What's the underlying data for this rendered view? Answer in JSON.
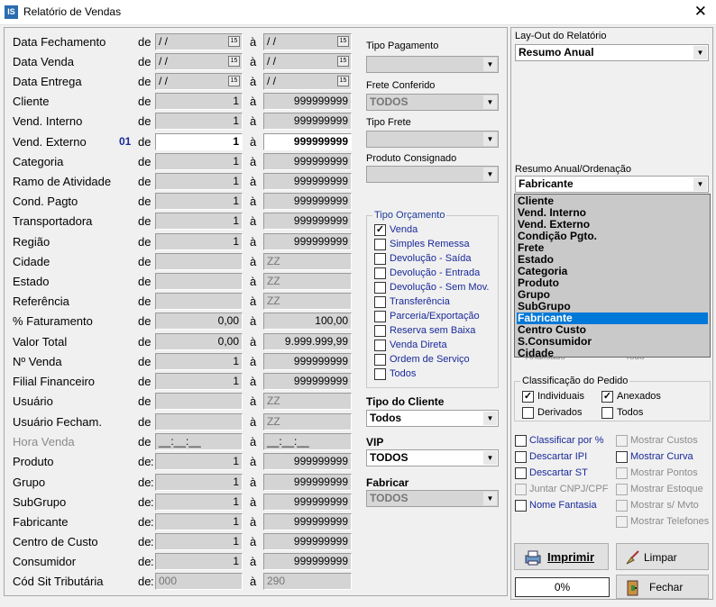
{
  "window": {
    "title": "Relatório de Vendas",
    "app_icon": "IS"
  },
  "filters": {
    "de": "de",
    "a": "à",
    "rows": [
      {
        "label": "Data Fechamento",
        "from": "/ /",
        "to": "/ /"
      },
      {
        "label": "Data Venda",
        "from": "/ /",
        "to": "/ /"
      },
      {
        "label": "Data Entrega",
        "from": "/ /",
        "to": "/ /"
      },
      {
        "label": "Cliente",
        "from": "1",
        "to": "999999999"
      },
      {
        "label": "Vend. Interno",
        "from": "1",
        "to": "999999999"
      },
      {
        "label": "Vend. Externo",
        "code": "01",
        "from": "1",
        "to": "999999999"
      },
      {
        "label": "Categoria",
        "from": "1",
        "to": "999999999"
      },
      {
        "label": "Ramo de Atividade",
        "from": "1",
        "to": "999999999"
      },
      {
        "label": "Cond. Pagto",
        "from": "1",
        "to": "999999999"
      },
      {
        "label": "Transportadora",
        "from": "1",
        "to": "999999999"
      },
      {
        "label": "Região",
        "from": "1",
        "to": "999999999"
      },
      {
        "label": "Cidade",
        "from": "",
        "to": "ZZ"
      },
      {
        "label": "Estado",
        "from": "",
        "to": "ZZ"
      },
      {
        "label": "Referência",
        "from": "",
        "to": "ZZ"
      },
      {
        "label": "% Faturamento",
        "from": "0,00",
        "to": "100,00"
      },
      {
        "label": "Valor Total",
        "from": "0,00",
        "to": "9.999.999,99"
      },
      {
        "label": "Nº Venda",
        "from": "1",
        "to": "999999999"
      },
      {
        "label": "Filial Financeiro",
        "from": "1",
        "to": "999999999"
      },
      {
        "label": "Usuário",
        "from": "",
        "to": "ZZ"
      },
      {
        "label": "Usuário Fecham.",
        "from": "",
        "to": "ZZ"
      },
      {
        "label": "Hora Venda",
        "from": "__:__:__",
        "to": "__:__:__"
      },
      {
        "label": "Produto",
        "from": "1",
        "to": "999999999"
      },
      {
        "label": "Grupo",
        "from": "1",
        "to": "999999999"
      },
      {
        "label": "SubGrupo",
        "from": "1",
        "to": "999999999"
      },
      {
        "label": "Fabricante",
        "from": "1",
        "to": "999999999"
      },
      {
        "label": "Centro de Custo",
        "from": "1",
        "to": "999999999"
      },
      {
        "label": "Consumidor",
        "from": "1",
        "to": "999999999"
      },
      {
        "label": "Cód Sit Tributária",
        "from": "000",
        "to": "290"
      }
    ]
  },
  "middle": {
    "tipo_pagamento_label": "Tipo Pagamento",
    "tipo_pagamento_value": "",
    "frete_conferido_label": "Frete Conferido",
    "frete_conferido_value": "TODOS",
    "tipo_frete_label": "Tipo Frete",
    "tipo_frete_value": "",
    "produto_consignado_label": "Produto Consignado",
    "produto_consignado_value": "",
    "tipo_orcamento_title": "Tipo Orçamento",
    "tipo_orcamento": [
      {
        "label": "Venda",
        "checked": true
      },
      {
        "label": "Simples Remessa",
        "checked": false
      },
      {
        "label": "Devolução - Saída",
        "checked": false
      },
      {
        "label": "Devolução - Entrada",
        "checked": false
      },
      {
        "label": "Devolução - Sem Mov.",
        "checked": false
      },
      {
        "label": "Transferência",
        "checked": false
      },
      {
        "label": "Parceria/Exportação",
        "checked": false
      },
      {
        "label": "Reserva sem Baixa",
        "checked": false
      },
      {
        "label": "Venda Direta",
        "checked": false
      },
      {
        "label": "Ordem de Serviço",
        "checked": false
      },
      {
        "label": "Todos",
        "checked": false
      }
    ],
    "tipo_cliente_label": "Tipo do Cliente",
    "tipo_cliente_value": "Todos",
    "vip_label": "VIP",
    "vip_value": "TODOS",
    "fabricar_label": "Fabricar",
    "fabricar_value": "TODOS"
  },
  "right": {
    "layout_label": "Lay-Out do Relatório",
    "layout_value": "Resumo Anual",
    "ordenacao_label": "Resumo Anual/Ordenação",
    "ordenacao_value": "Fabricante",
    "ordenacao_options": [
      "Cliente",
      "Vend. Interno",
      "Vend. Externo",
      "Condição Pgto.",
      "Frete",
      "Estado",
      "Categoria",
      "Produto",
      "Grupo",
      "SubGrupo",
      "Fabricante",
      "Centro Custo",
      "S.Consumidor",
      "Cidade"
    ],
    "selected_option": "Fabricante",
    "hidden_behind_a": "Analisado",
    "hidden_behind_b": "Todo",
    "classificacao_title": "Classificação do Pedido",
    "classificacao": [
      {
        "label": "Individuais",
        "checked": true
      },
      {
        "label": "Anexados",
        "checked": true
      },
      {
        "label": "Derivados",
        "checked": false
      },
      {
        "label": "Todos",
        "checked": false
      }
    ],
    "options_left": [
      {
        "label": "Classificar por %",
        "enabled": true
      },
      {
        "label": "Descartar IPI",
        "enabled": true
      },
      {
        "label": "Descartar ST",
        "enabled": true
      },
      {
        "label": "Juntar CNPJ/CPF",
        "enabled": false
      },
      {
        "label": "Nome Fantasia",
        "enabled": true
      }
    ],
    "options_right": [
      {
        "label": "Mostrar Custos",
        "enabled": false
      },
      {
        "label": "Mostrar Curva",
        "enabled": true
      },
      {
        "label": "Mostrar Pontos",
        "enabled": false
      },
      {
        "label": "Mostrar Estoque",
        "enabled": false
      },
      {
        "label": "Mostrar s/ Mvto",
        "enabled": false
      },
      {
        "label": "Mostrar Telefones",
        "enabled": false
      }
    ],
    "imprimir_label": "Imprimir",
    "limpar_label": "Limpar",
    "fechar_label": "Fechar",
    "progress": "0%"
  }
}
